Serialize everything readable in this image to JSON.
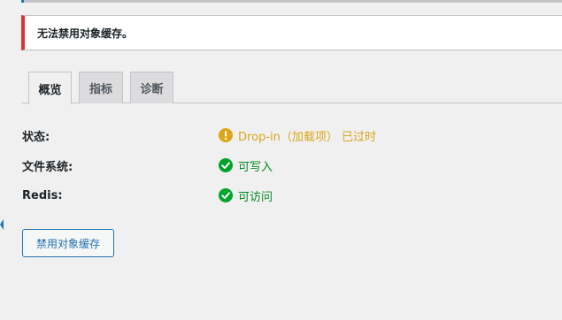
{
  "notice": {
    "text": "无法禁用对象缓存。"
  },
  "tabs": [
    {
      "label": "概览",
      "active": true
    },
    {
      "label": "指标",
      "active": false
    },
    {
      "label": "诊断",
      "active": false
    }
  ],
  "status_rows": [
    {
      "label": "状态:",
      "value": "Drop-in（加载项） 已过时",
      "state": "warning",
      "icon": "exclamation-icon",
      "color": "#dba617"
    },
    {
      "label": "文件系统:",
      "value": "可写入",
      "state": "ok",
      "icon": "checkmark-icon",
      "color": "#00a32a"
    },
    {
      "label": "Redis:",
      "value": "可访问",
      "state": "ok",
      "icon": "checkmark-icon",
      "color": "#00a32a"
    }
  ],
  "actions": {
    "disable_button": "禁用对象缓存"
  },
  "colors": {
    "error_border": "#d63638",
    "accent": "#2271b1",
    "warning": "#dba617",
    "success": "#00a32a"
  }
}
